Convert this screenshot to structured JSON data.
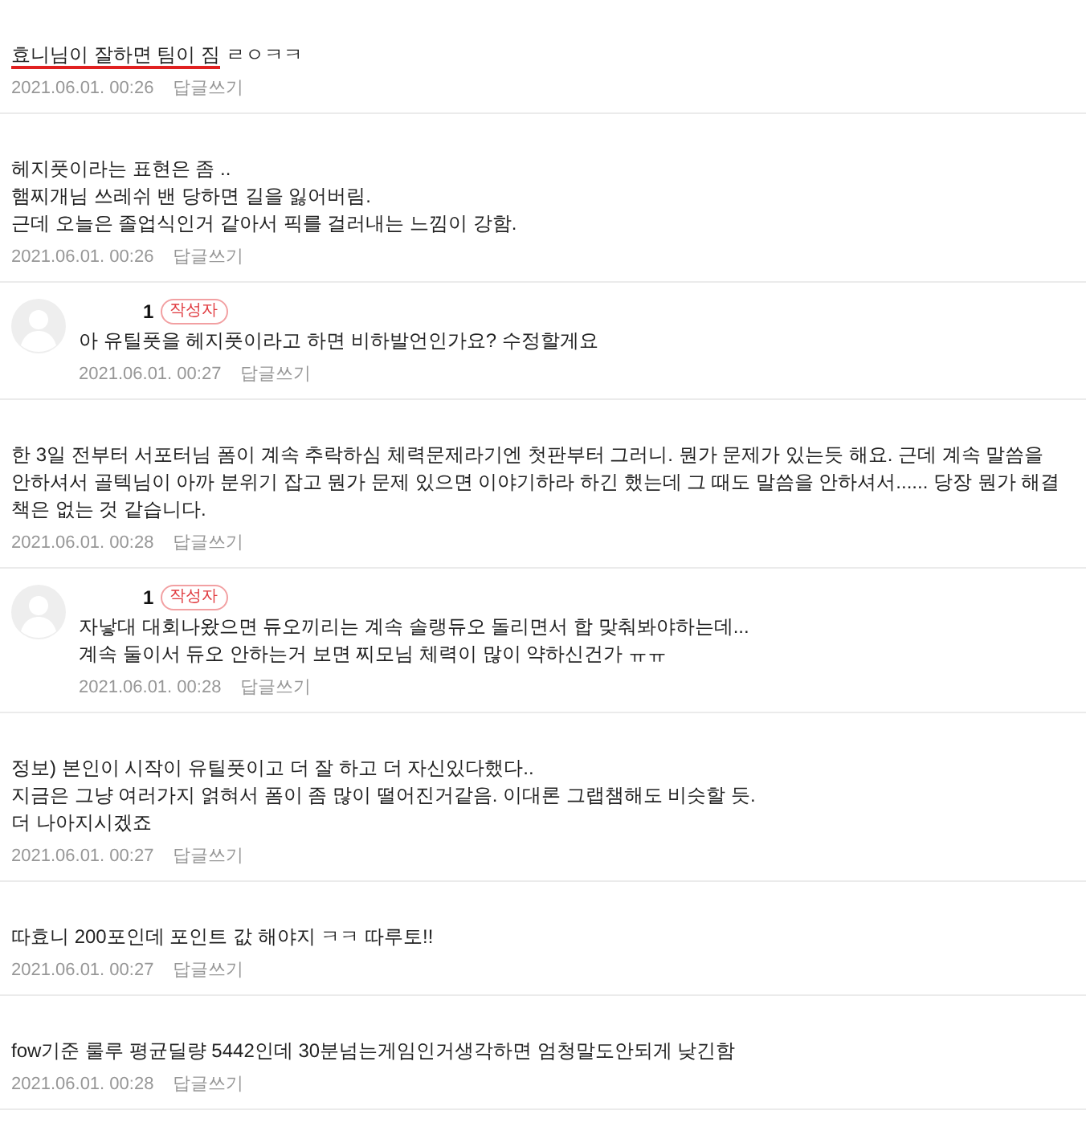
{
  "comments": [
    {
      "reply": false,
      "author_badge": false,
      "lines": [
        [
          {
            "text": "효니님이 잘하면 팀이 짐",
            "underlined": true
          },
          {
            "text": " ㄹㅇㅋㅋ",
            "underlined": false
          }
        ]
      ],
      "date": "2021.06.01. 00:26",
      "reply_link": "답글쓰기"
    },
    {
      "reply": false,
      "author_badge": false,
      "lines": [
        [
          {
            "text": "헤지풋이라는 표현은 좀 ..",
            "underlined": false
          }
        ],
        [
          {
            "text": "햄찌개님 쓰레쉬 밴 당하면 길을 잃어버림.",
            "underlined": false
          }
        ],
        [
          {
            "text": "근데 오늘은 졸업식인거 같아서 픽를 걸러내는 느낌이 강함.",
            "underlined": false
          }
        ]
      ],
      "date": "2021.06.01. 00:26",
      "reply_link": "답글쓰기"
    },
    {
      "reply": true,
      "author": "1",
      "author_badge": true,
      "badge": "작성자",
      "lines": [
        [
          {
            "text": "아 유틸풋을 헤지풋이라고 하면 비하발언인가요? 수정할게요",
            "underlined": false
          }
        ]
      ],
      "date": "2021.06.01. 00:27",
      "reply_link": "답글쓰기"
    },
    {
      "reply": false,
      "author_badge": false,
      "lines": [
        [
          {
            "text": "한 3일 전부터 서포터님 폼이 계속 추락하심 체력문제라기엔 첫판부터 그러니. 뭔가 문제가 있는듯 해요. 근데 계속 말씀을 안하셔서 골텍님이 아까 분위기 잡고 뭔가 문제 있으면 이야기하라 하긴 했는데 그 때도 말씀을 안하셔서...... 당장 뭔가 해결책은 없는 것 같습니다.",
            "underlined": false
          }
        ]
      ],
      "date": "2021.06.01. 00:28",
      "reply_link": "답글쓰기"
    },
    {
      "reply": true,
      "author": "1",
      "author_badge": true,
      "badge": "작성자",
      "lines": [
        [
          {
            "text": "자낳대 대회나왔으면 듀오끼리는 계속 솔랭듀오 돌리면서 합 맞춰봐야하는데...",
            "underlined": false
          }
        ],
        [
          {
            "text": "계속 둘이서 듀오 안하는거 보면 찌모님 체력이 많이 약하신건가 ㅠㅠ",
            "underlined": false
          }
        ]
      ],
      "date": "2021.06.01. 00:28",
      "reply_link": "답글쓰기"
    },
    {
      "reply": false,
      "author_badge": false,
      "lines": [
        [
          {
            "text": "정보) 본인이 시작이 유틸풋이고 더 잘 하고 더 자신있다했다..",
            "underlined": false
          }
        ],
        [
          {
            "text": "지금은 그냥 여러가지 얽혀서 폼이 좀 많이 떨어진거같음. 이대론 그랩챔해도 비슷할 듯.",
            "underlined": false
          }
        ],
        [
          {
            "text": "더 나아지시겠죠",
            "underlined": false
          }
        ]
      ],
      "date": "2021.06.01. 00:27",
      "reply_link": "답글쓰기"
    },
    {
      "reply": false,
      "author_badge": false,
      "lines": [
        [
          {
            "text": "따효니 200포인데 포인트 값 해야지 ㅋㅋ 따루토!!",
            "underlined": false
          }
        ]
      ],
      "date": "2021.06.01. 00:27",
      "reply_link": "답글쓰기"
    },
    {
      "reply": false,
      "author_badge": false,
      "lines": [
        [
          {
            "text": "fow기준 룰루 평균딜량 5442인데 30분넘는게임인거생각하면 엄청말도안되게 낮긴함",
            "underlined": false
          }
        ]
      ],
      "date": "2021.06.01. 00:28",
      "reply_link": "답글쓰기"
    }
  ]
}
